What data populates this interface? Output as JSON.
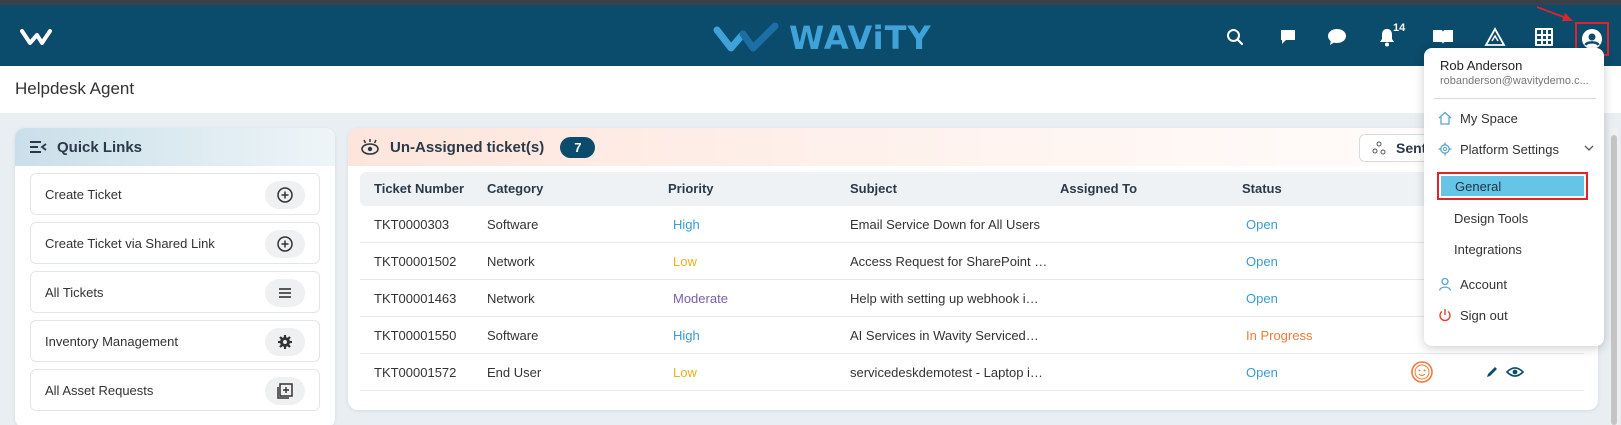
{
  "topbar": {
    "brand": "WAViTY",
    "notification_count": "14",
    "icons": [
      "search-icon",
      "feedback-icon",
      "chat-icon",
      "bell-icon",
      "book-icon",
      "triangle-icon",
      "grid-icon",
      "user-icon"
    ]
  },
  "page": {
    "title": "Helpdesk Agent"
  },
  "quick_links": {
    "title": "Quick Links",
    "items": [
      {
        "label": "Create Ticket",
        "icon": "plus-circle-icon"
      },
      {
        "label": "Create Ticket via Shared Link",
        "icon": "plus-circle-icon"
      },
      {
        "label": "All Tickets",
        "icon": "list-icon"
      },
      {
        "label": "Inventory Management",
        "icon": "gear-icon"
      },
      {
        "label": "All Asset Requests",
        "icon": "asset-icon"
      }
    ]
  },
  "tickets": {
    "title": "Un-Assigned ticket(s)",
    "count": "7",
    "sent_label": "Sent",
    "columns": [
      "Ticket Number",
      "Category",
      "Priority",
      "Subject",
      "Assigned To",
      "Status"
    ],
    "rows": [
      {
        "number": "TKT0000303",
        "category": "Software",
        "priority": "High",
        "subject": "Email Service Down for All Users",
        "assigned": "",
        "status": "Open"
      },
      {
        "number": "TKT00001502",
        "category": "Network",
        "priority": "Low",
        "subject": "Access Request for SharePoint …",
        "assigned": "",
        "status": "Open"
      },
      {
        "number": "TKT00001463",
        "category": "Network",
        "priority": "Moderate",
        "subject": "Help with setting up webhook i…",
        "assigned": "",
        "status": "Open"
      },
      {
        "number": "TKT00001550",
        "category": "Software",
        "priority": "High",
        "subject": "AI Services in Wavity Serviced…",
        "assigned": "",
        "status": "In Progress"
      },
      {
        "number": "TKT00001572",
        "category": "End User",
        "priority": "Low",
        "subject": "servicedeskdemotest - Laptop i…",
        "assigned": "",
        "status": "Open"
      }
    ],
    "colors": {
      "high": "#3a9bd5",
      "low": "#e8b21a",
      "moderate": "#7a5ea8",
      "open": "#3a9bd5",
      "in_progress": "#f07a3a"
    }
  },
  "user_menu": {
    "name": "Rob Anderson",
    "email": "robanderson@wavitydemo.c...",
    "items": {
      "my_space": "My Space",
      "platform_settings": "Platform Settings",
      "general": "General",
      "design_tools": "Design Tools",
      "integrations": "Integrations",
      "account": "Account",
      "sign_out": "Sign out"
    }
  }
}
